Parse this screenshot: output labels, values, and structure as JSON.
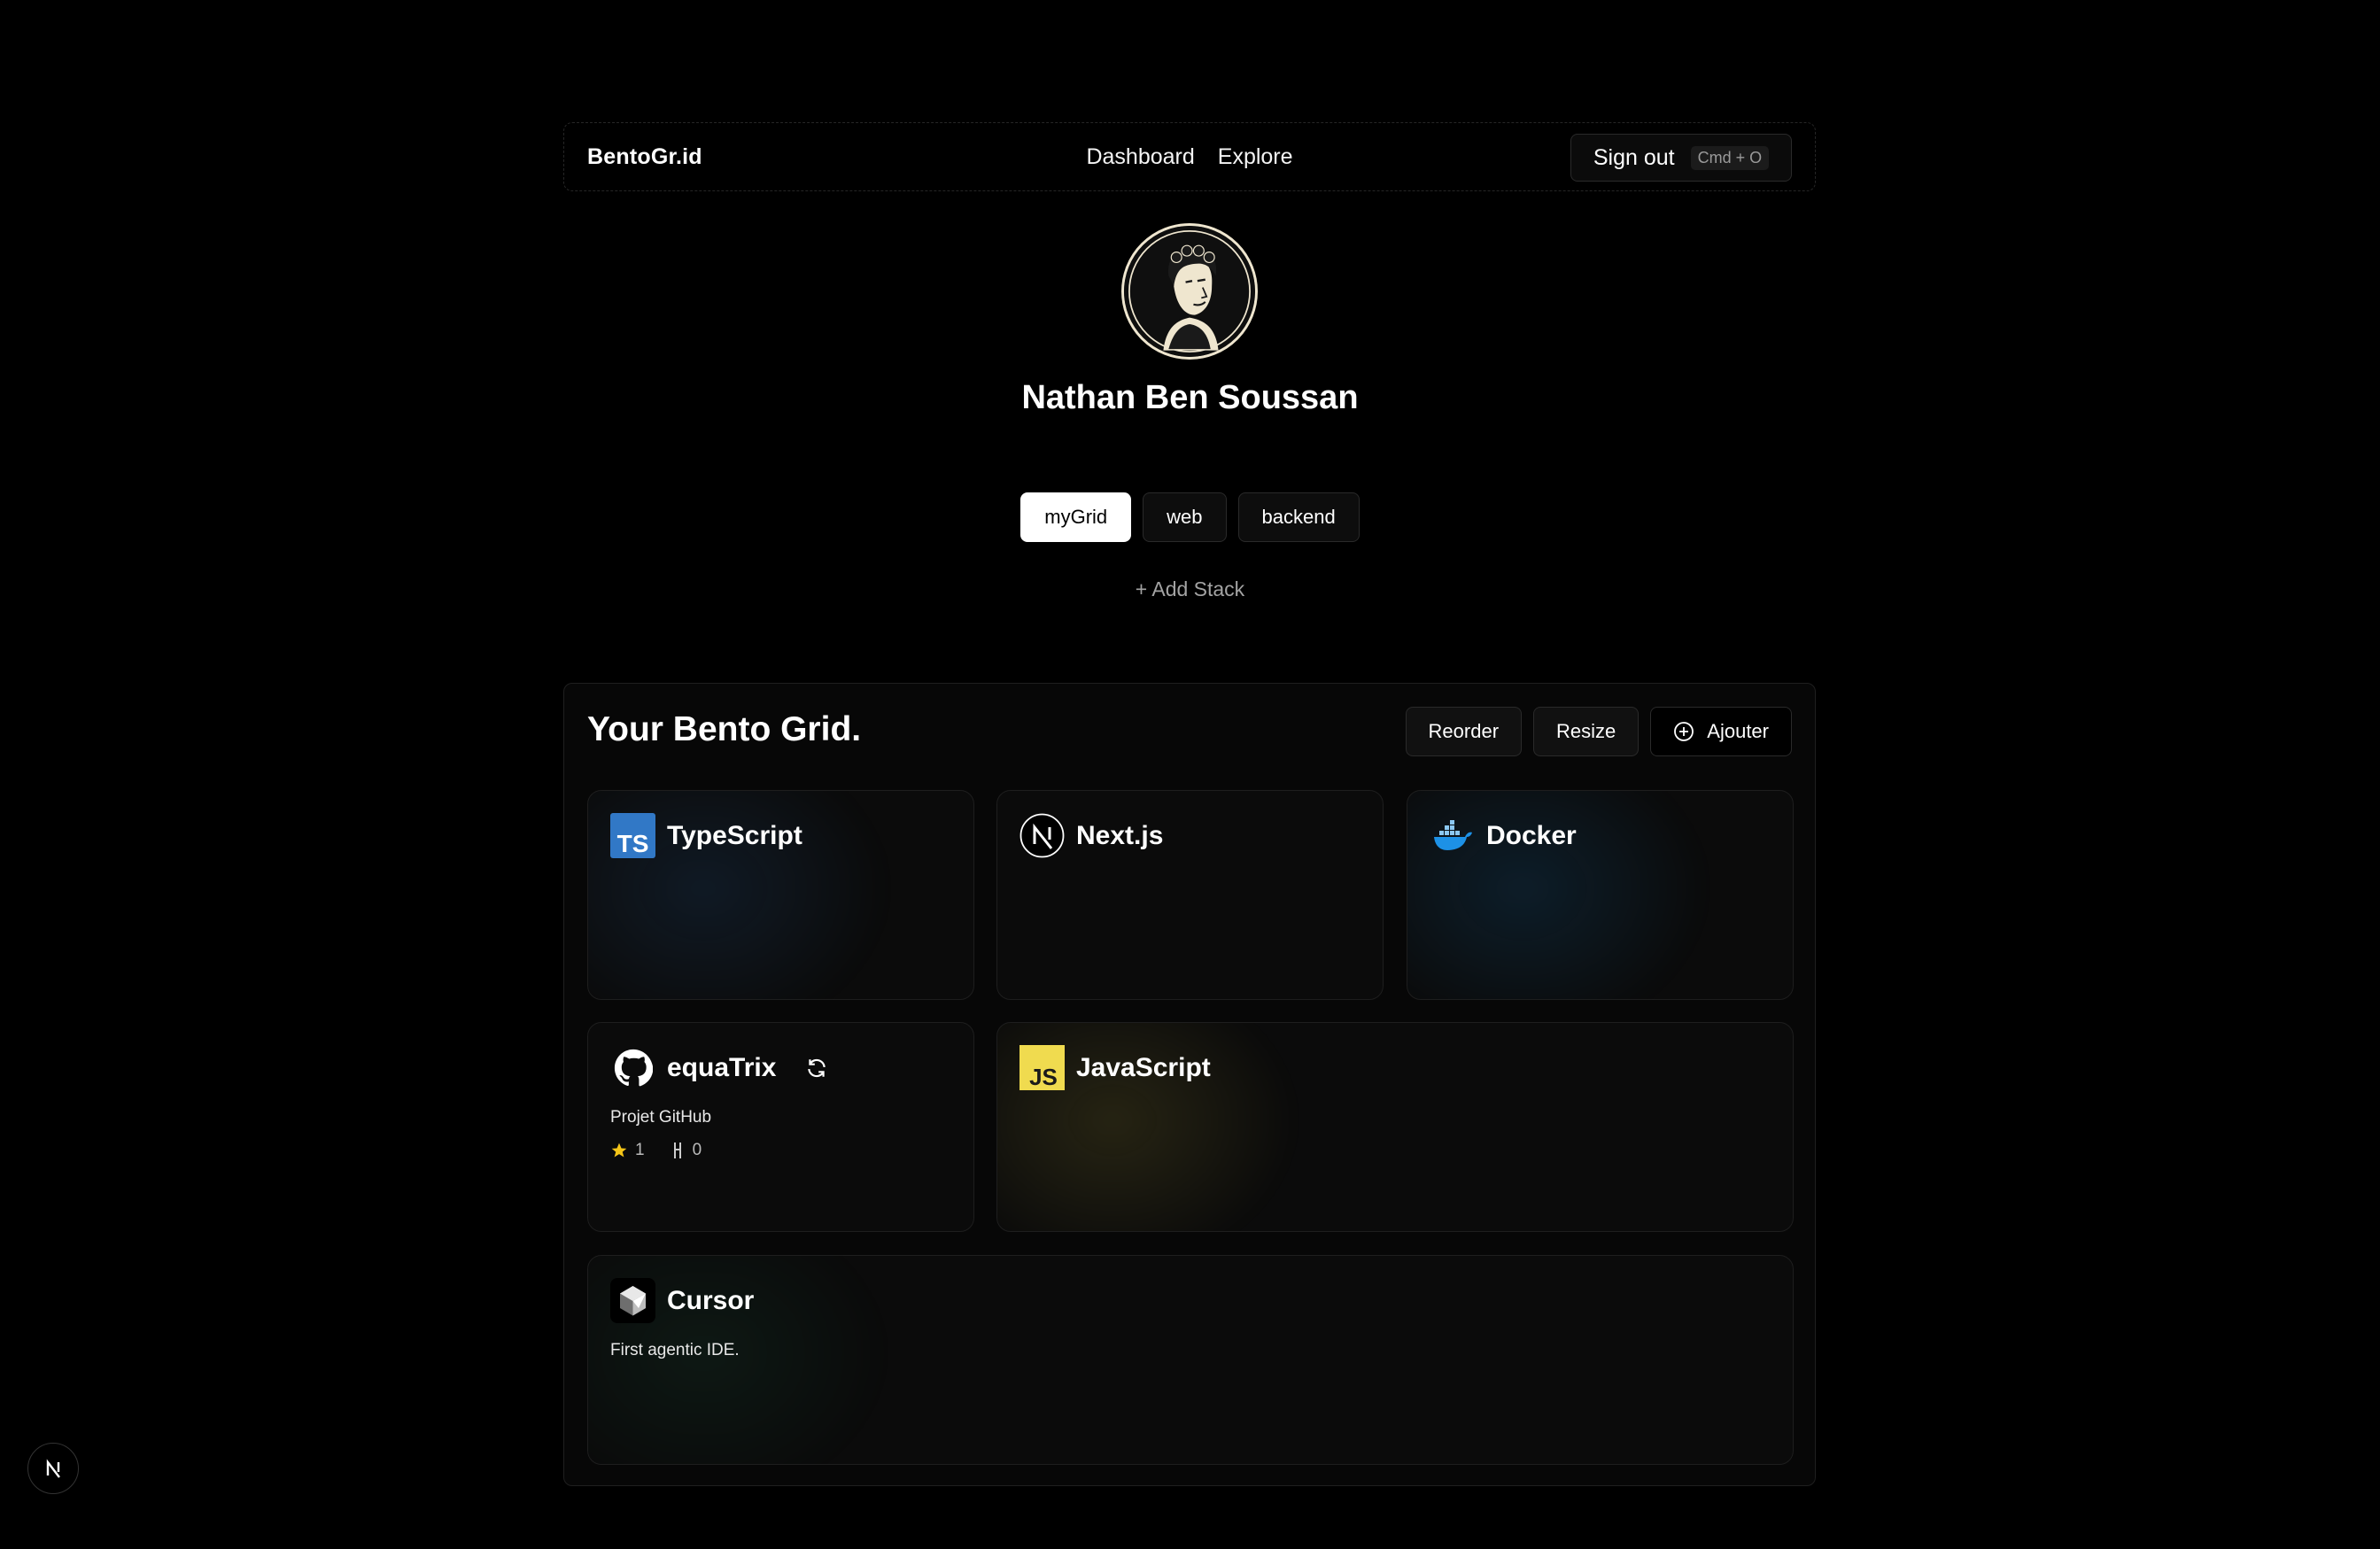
{
  "nav": {
    "brand": "BentoGr.id",
    "links": [
      "Dashboard",
      "Explore"
    ],
    "signout_label": "Sign out",
    "signout_shortcut": "Cmd + O"
  },
  "profile": {
    "name": "Nathan Ben Soussan"
  },
  "stacks": {
    "items": [
      "myGrid",
      "web",
      "backend"
    ],
    "active": "myGrid",
    "add_label": "+ Add Stack"
  },
  "panel": {
    "title": "Your Bento Grid.",
    "reorder_label": "Reorder",
    "resize_label": "Resize",
    "add_label": "Ajouter"
  },
  "cards": {
    "typescript": {
      "title": "TypeScript",
      "icon": "typescript-icon"
    },
    "nextjs": {
      "title": "Next.js",
      "icon": "nextjs-icon"
    },
    "docker": {
      "title": "Docker",
      "icon": "docker-icon"
    },
    "equatrix": {
      "title": "equaTrix",
      "icon": "github-icon",
      "desc": "Projet GitHub",
      "stars": "1",
      "forks": "0"
    },
    "javascript": {
      "title": "JavaScript",
      "icon": "javascript-icon"
    },
    "cursor": {
      "title": "Cursor",
      "icon": "cursor-icon",
      "desc": "First agentic IDE."
    }
  },
  "colors": {
    "background": "#000000",
    "typescript": "#3178c6",
    "javascript": "#f0db4f",
    "docker": "#1d91e6"
  }
}
